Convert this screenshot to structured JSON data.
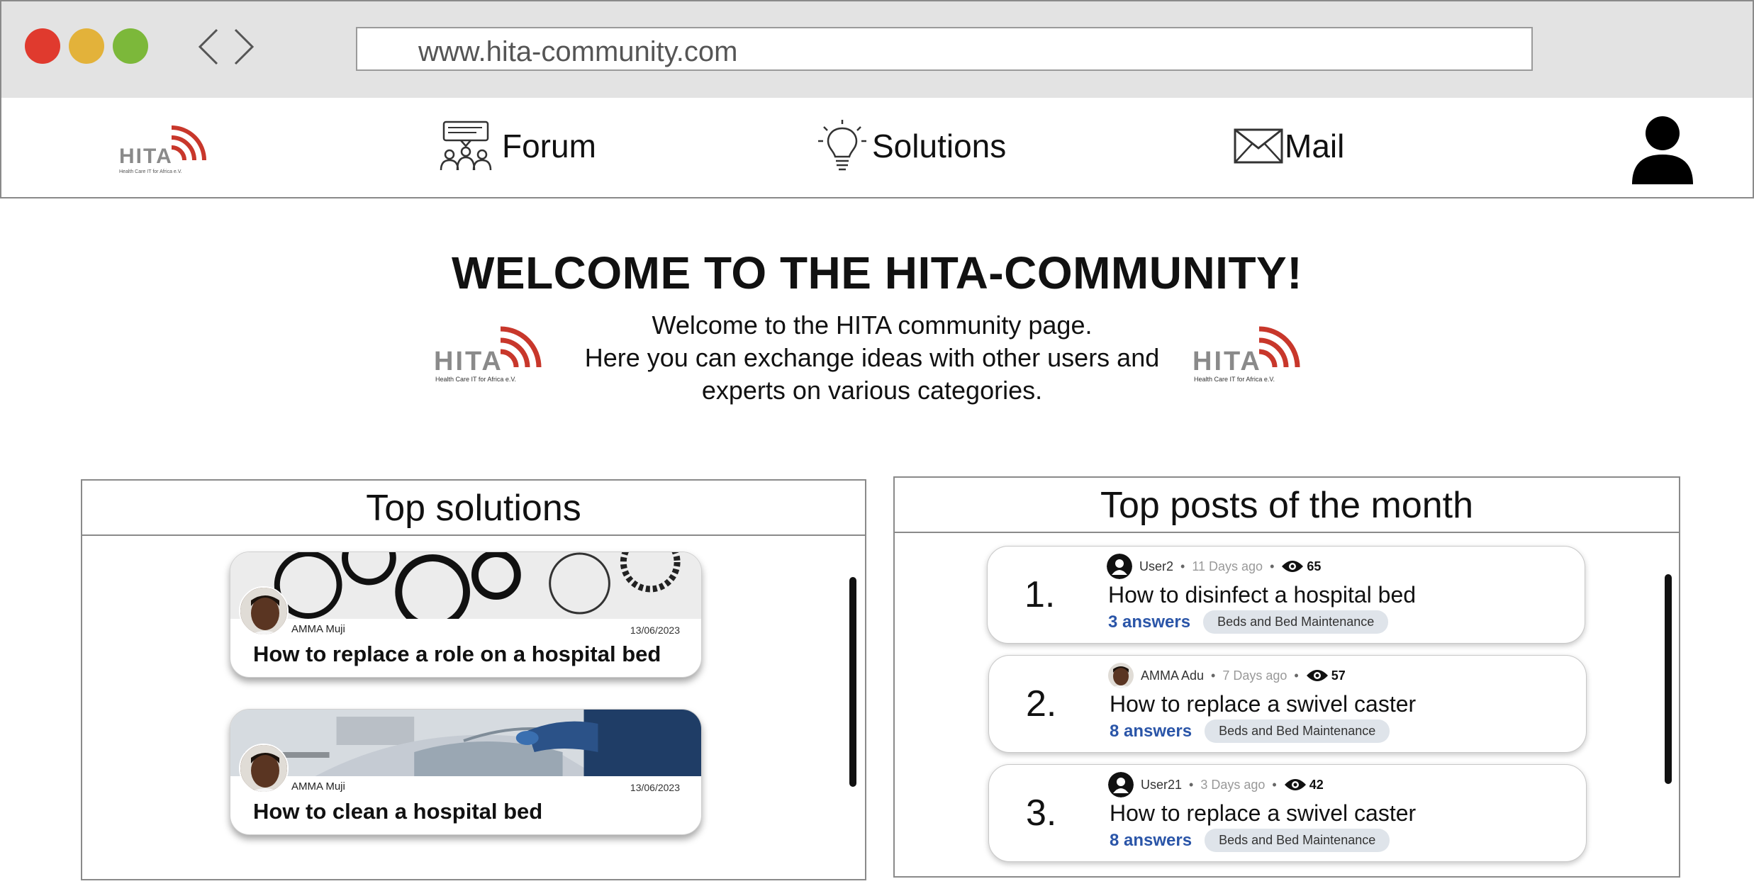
{
  "browser": {
    "url": "www.hita-community.com"
  },
  "nav": {
    "logo_text": "HITA",
    "logo_tagline": "Health Care IT for Africa e.V.",
    "items": [
      {
        "label": "Forum",
        "icon": "forum-icon"
      },
      {
        "label": "Solutions",
        "icon": "lightbulb-icon"
      },
      {
        "label": "Mail",
        "icon": "mail-icon"
      }
    ],
    "profile_icon": "user-icon"
  },
  "welcome": {
    "title": "WELCOME TO THE HITA-COMMUNITY!",
    "line1": "Welcome to the HITA community page.",
    "line2": "Here you can exchange ideas with other users and",
    "line3": "experts on various categories."
  },
  "top_solutions": {
    "heading": "Top solutions",
    "cards": [
      {
        "author": "AMMA Muji",
        "date": "13/06/2023",
        "title": "How to replace a role on a hospital bed"
      },
      {
        "author": "AMMA Muji",
        "date": "13/06/2023",
        "title": "How to clean a hospital bed"
      }
    ]
  },
  "top_posts": {
    "heading": "Top posts of the month",
    "posts": [
      {
        "rank": "1.",
        "user": "User2",
        "ago": "11 Days ago",
        "views": "65",
        "title": "How to disinfect a hospital bed",
        "answers": "3 answers",
        "tag": "Beds and Bed Maintenance"
      },
      {
        "rank": "2.",
        "user": "AMMA Adu",
        "ago": "7 Days ago",
        "views": "57",
        "title": "How to replace a swivel caster",
        "answers": "8 answers",
        "tag": "Beds and Bed Maintenance"
      },
      {
        "rank": "3.",
        "user": "User21",
        "ago": "3 Days ago",
        "views": "42",
        "title": "How to replace a swivel caster",
        "answers": "8 answers",
        "tag": "Beds and Bed Maintenance"
      }
    ]
  },
  "colors": {
    "accent_red": "#c8372b",
    "answers_blue": "#2a55a8",
    "tag_bg": "#dfe4ea"
  }
}
